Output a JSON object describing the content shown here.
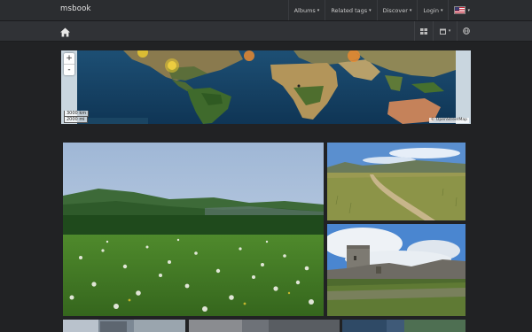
{
  "app": {
    "brand": "msbook"
  },
  "nav": {
    "items": [
      {
        "label": "Albums"
      },
      {
        "label": "Related tags"
      },
      {
        "label": "Discover"
      },
      {
        "label": "Login"
      }
    ],
    "language_icon": "us-flag-icon"
  },
  "toolbar": {
    "home_icon": "home-icon",
    "view_icon": "grid-icon",
    "calendar_icon": "calendar-icon",
    "globe_icon": "globe-icon"
  },
  "map": {
    "zoom_in": "+",
    "zoom_out": "-",
    "scale_km": "3000 km",
    "scale_mi": "2000 mi",
    "attribution": "© OpenStreetMap"
  },
  "photos": [
    {
      "subject": "dandelion-meadow-hills"
    },
    {
      "subject": "grassland-path-mountains"
    },
    {
      "subject": "castle-ruins-tower"
    },
    {
      "subject": "town-street"
    },
    {
      "subject": "rocky-landscape"
    },
    {
      "subject": "coastal-scene"
    }
  ],
  "colors": {
    "topbar": "#2b2d30",
    "background": "#212224",
    "map_cluster": "#e8c830"
  }
}
